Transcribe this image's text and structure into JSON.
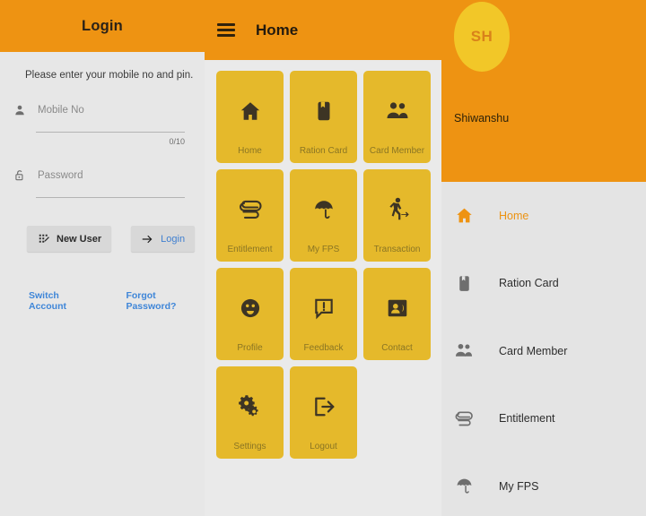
{
  "login": {
    "header_title": "Login",
    "instruction": "Please enter your mobile no and pin.",
    "mobile": {
      "icon": "person-icon",
      "placeholder": "Mobile No",
      "value": "",
      "counter": "0/10"
    },
    "password": {
      "icon": "lock-icon",
      "placeholder": "Password",
      "value": ""
    },
    "new_user_button": {
      "label": "New User",
      "icon": "keypad-icon"
    },
    "login_button": {
      "label": "Login",
      "icon": "arrow-right-icon"
    },
    "switch_account_link": "Switch Account",
    "forgot_password_link": "Forgot Password?"
  },
  "center": {
    "menu_icon": "hamburger-icon",
    "title": "Home",
    "tiles": [
      {
        "label": "Home",
        "icon": "home-icon"
      },
      {
        "label": "Ration Card",
        "icon": "card-icon"
      },
      {
        "label": "Card Member",
        "icon": "people-icon"
      },
      {
        "label": "Entitlement",
        "icon": "paperclip-icon"
      },
      {
        "label": "My FPS",
        "icon": "umbrella-icon"
      },
      {
        "label": "Transaction",
        "icon": "person-walking-icon"
      },
      {
        "label": "Profile",
        "icon": "profile-face-icon"
      },
      {
        "label": "Feedback",
        "icon": "chat-alert-icon"
      },
      {
        "label": "Contact",
        "icon": "contact-card-icon"
      },
      {
        "label": "Settings",
        "icon": "gears-icon"
      },
      {
        "label": "Logout",
        "icon": "logout-icon"
      }
    ]
  },
  "drawer": {
    "avatar_initials": "SH",
    "user_name": "Shiwanshu",
    "items": [
      {
        "label": "Home",
        "icon": "home-icon",
        "active": true
      },
      {
        "label": "Ration Card",
        "icon": "card-icon",
        "active": false
      },
      {
        "label": "Card Member",
        "icon": "people-icon",
        "active": false
      },
      {
        "label": "Entitlement",
        "icon": "paperclip-icon",
        "active": false
      },
      {
        "label": "My FPS",
        "icon": "umbrella-icon",
        "active": false
      }
    ]
  },
  "colors": {
    "orange": "#ee9312",
    "tile_yellow": "#e5b92b",
    "avatar_yellow": "#f2c728",
    "link_blue": "#3f86d8",
    "panel_gray": "#e6e6e6"
  }
}
